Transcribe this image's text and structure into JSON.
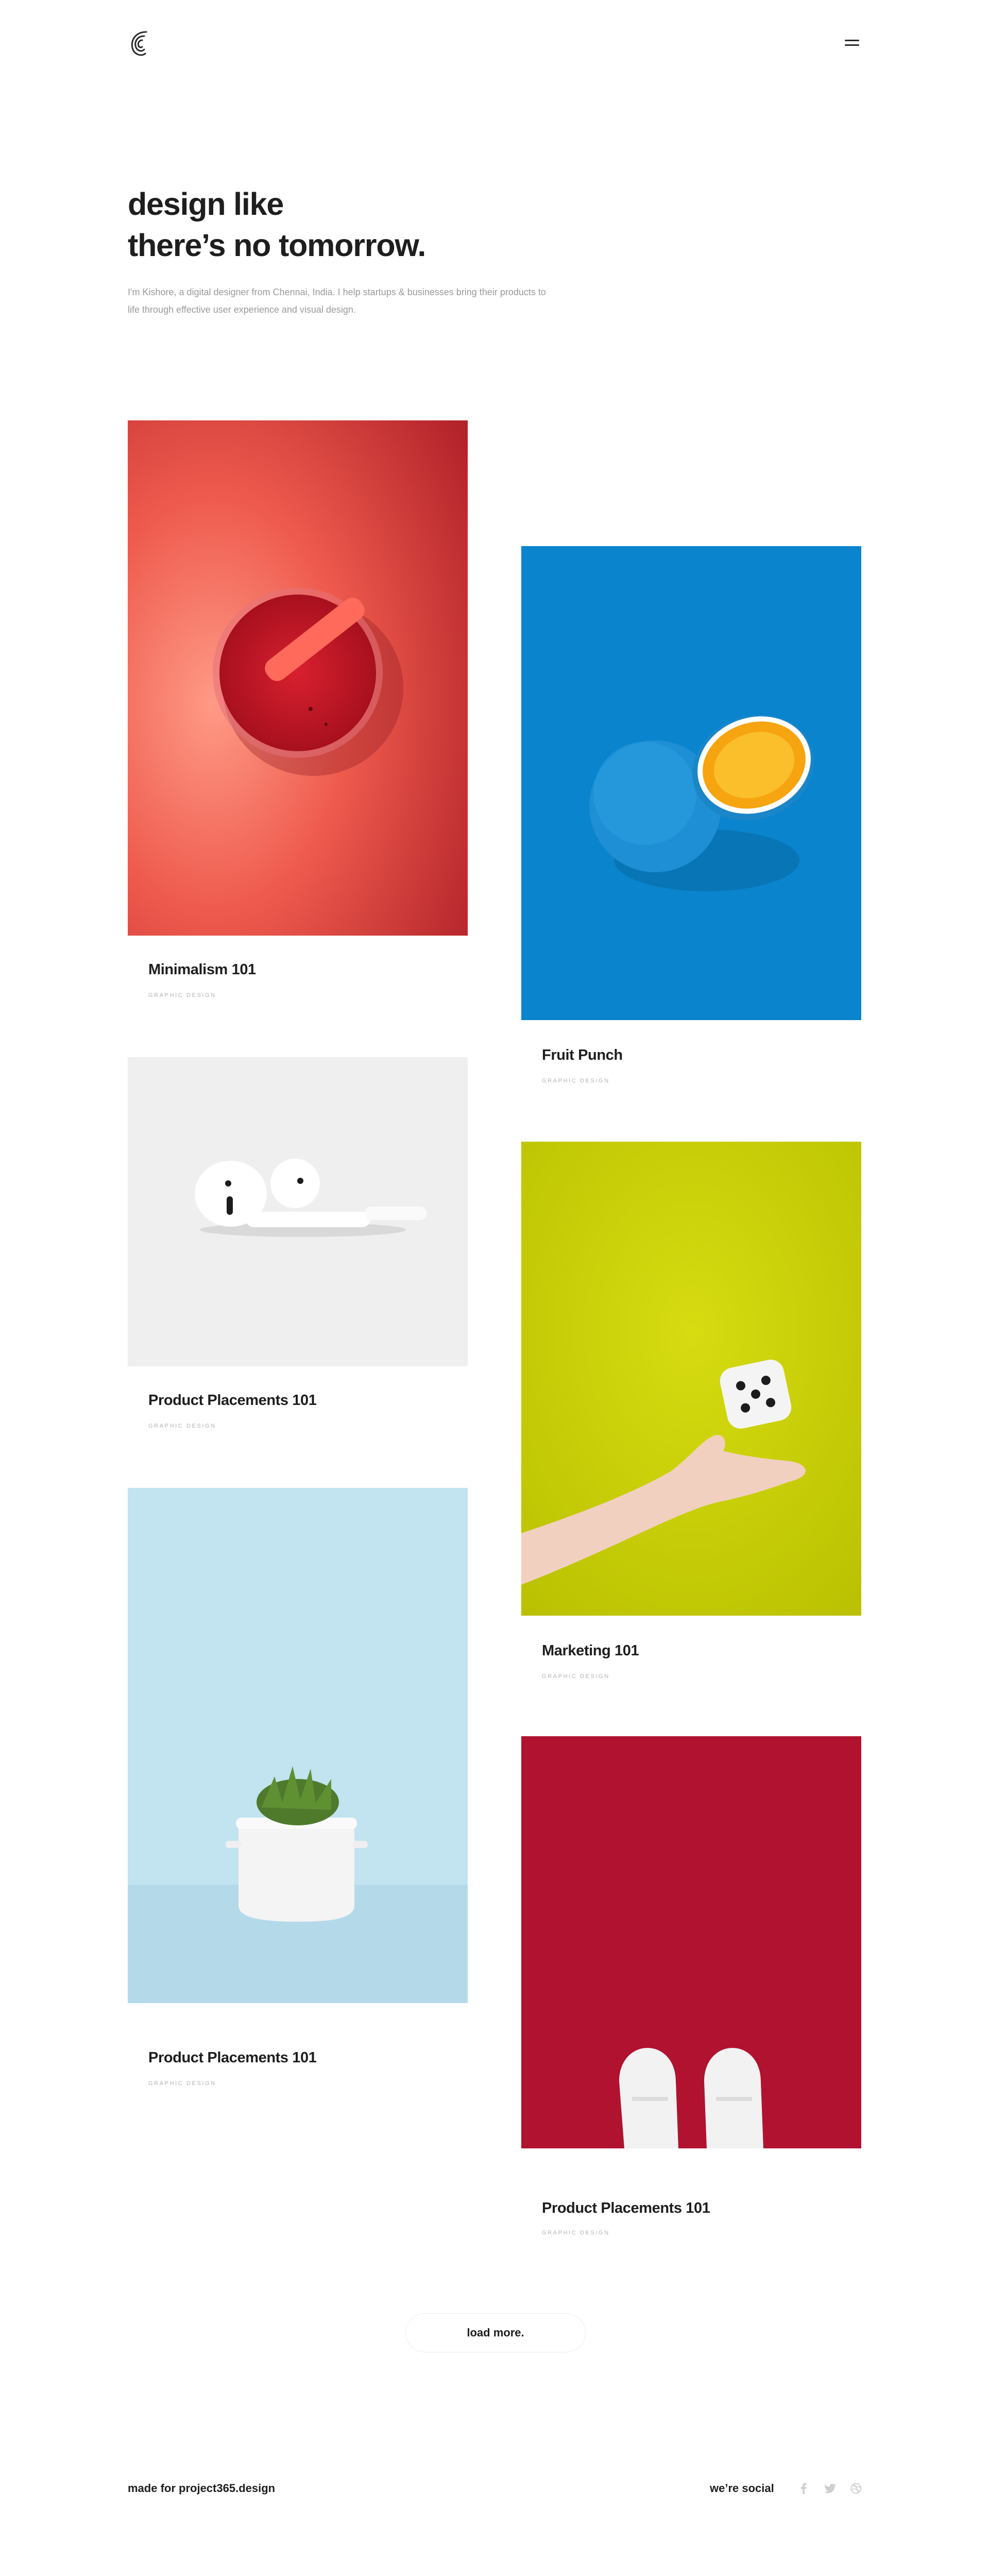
{
  "brand": {
    "logo_icon": "spiral-logo-icon"
  },
  "header": {
    "menu_icon": "hamburger-menu-icon"
  },
  "hero": {
    "title_line1": "design like",
    "title_line2": "there’s no tomorrow.",
    "description_line1": "I'm Kishore, a digital designer from Chennai, India. I help startups & businesses bring their products to",
    "description_line2": "life through effective user experience and visual design."
  },
  "portfolio": [
    {
      "title": "Minimalism 101",
      "category": "GRAPHIC DESIGN",
      "image": "red-juice-glass-image",
      "bg": "#e84b45"
    },
    {
      "title": "Fruit Punch",
      "category": "GRAPHIC DESIGN",
      "image": "blue-orange-image",
      "bg": "#0a84cc"
    },
    {
      "title": "Product Placements 101",
      "category": "GRAPHIC DESIGN",
      "image": "airpods-image",
      "bg": "#eeeeee"
    },
    {
      "title": "Marketing 101",
      "category": "GRAPHIC DESIGN",
      "image": "hand-dice-image",
      "bg": "#cfd600"
    },
    {
      "title": "Product Placements 101",
      "category": "GRAPHIC DESIGN",
      "image": "succulent-pot-image",
      "bg": "#bde0ee"
    },
    {
      "title": "Product Placements 101",
      "category": "GRAPHIC DESIGN",
      "image": "white-sneakers-image",
      "bg": "#b0102f"
    }
  ],
  "load_more": {
    "label": "load more."
  },
  "footer": {
    "made_for": "made for project365.design",
    "social_label": "we’re social",
    "social_icons": [
      "facebook-icon",
      "twitter-icon",
      "dribbble-icon"
    ]
  }
}
